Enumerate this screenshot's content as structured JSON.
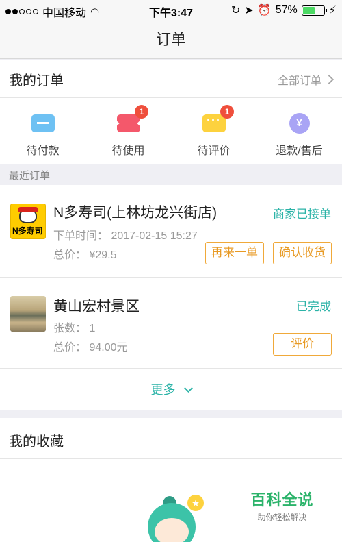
{
  "status_bar": {
    "carrier": "中国移动",
    "time": "下午3:47",
    "battery": "57%",
    "battery_level": 0.57
  },
  "nav": {
    "title": "订单"
  },
  "my_orders": {
    "title": "我的订单",
    "all_link": "全部订单"
  },
  "order_status": [
    {
      "label": "待付款",
      "icon": "card-icon"
    },
    {
      "label": "待使用",
      "icon": "ticket-icon",
      "badge": "1"
    },
    {
      "label": "待评价",
      "icon": "chat-icon",
      "badge": "1"
    },
    {
      "label": "退款/售后",
      "icon": "yen-icon",
      "glyph": "¥"
    }
  ],
  "recent": {
    "label": "最近订单",
    "orders": [
      {
        "name": "N多寿司(上林坊龙兴街店)",
        "status": "商家已接单",
        "line1": "下单时间：  2017-02-15 15:27",
        "line2": "总价：  ¥29.5",
        "thumb_text": "N多寿司",
        "buttons": [
          "再来一单",
          "确认收货"
        ]
      },
      {
        "name": "黄山宏村景区",
        "status": "已完成",
        "line1": "张数：  1",
        "line2": "总价：  94.00元",
        "buttons": [
          "评价"
        ]
      }
    ],
    "more": "更多"
  },
  "favorites": {
    "title": "我的收藏"
  },
  "watermark": {
    "title": "百科全说",
    "subtitle": "助你轻松解决"
  },
  "colors": {
    "accent": "#2bb3a7",
    "button": "#e89a24",
    "badge": "#ef4f3c"
  }
}
